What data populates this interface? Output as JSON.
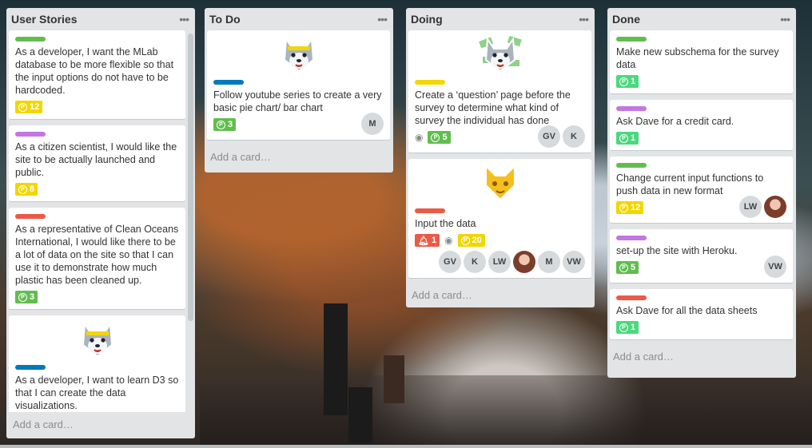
{
  "colors": {
    "green": "#61bd4f",
    "yellow": "#f2d600",
    "purple": "#c377e0",
    "red": "#eb5a46",
    "blue": "#0079bf"
  },
  "add_card_label": "Add a card…",
  "lists": [
    {
      "title": "User Stories",
      "cards": [
        {
          "label": "green",
          "text": "As a developer, I want the MLab database to be more flexible so that the input options do not have to be hardcoded.",
          "points": "12",
          "points_color": "yellow"
        },
        {
          "label": "purple",
          "text": "As a citizen scientist, I would like the site to be actually launched and public.",
          "points": "8",
          "points_color": "yellow"
        },
        {
          "label": "red",
          "text": "As a representative of Clean Oceans International, I would like there to be a lot of data on the site so that I can use it to demonstrate how much plastic has been cleaned up.",
          "points": "3",
          "points_color": "green"
        },
        {
          "label": "blue",
          "image": "husky-sticker-icon",
          "text": "As a developer, I want to learn D3 so that I can create the data visualizations."
        }
      ]
    },
    {
      "title": "To Do",
      "cards": [
        {
          "label": "blue",
          "image": "husky-sticker-icon",
          "text": "Follow youtube series to create a very basic pie chart/ bar chart",
          "points": "3",
          "points_color": "green",
          "members": [
            "M"
          ]
        }
      ]
    },
    {
      "title": "Doing",
      "cards": [
        {
          "label": "yellow",
          "image": "husky-money-sticker-icon",
          "text": "Create a ‘question’ page before the survey to determine what kind of survey the individual has done",
          "watch": true,
          "points": "5",
          "points_color": "green",
          "members": [
            "GV",
            "K"
          ]
        },
        {
          "label": "red",
          "image": "fox-sticker-icon",
          "text": "Input the data",
          "alert": "1",
          "watch": true,
          "points": "20",
          "points_color": "yellow",
          "members": [
            "GV",
            "K",
            "LW",
            "photo",
            "M",
            "VW"
          ]
        }
      ]
    },
    {
      "title": "Done",
      "cards": [
        {
          "label": "green",
          "text": "Make new subschema for the survey data",
          "points": "1",
          "points_color": "green-light"
        },
        {
          "label": "purple",
          "text": "Ask Dave for a credit card.",
          "points": "1",
          "points_color": "green-light"
        },
        {
          "label": "green",
          "text": "Change current input functions to push data in new format",
          "points": "12",
          "points_color": "yellow",
          "members": [
            "LW",
            "photo"
          ]
        },
        {
          "label": "purple",
          "text": "set-up the site with Heroku.",
          "points": "5",
          "points_color": "green",
          "members": [
            "VW"
          ]
        },
        {
          "label": "red",
          "text": "Ask Dave for all the data sheets",
          "points": "1",
          "points_color": "green-light"
        }
      ]
    }
  ]
}
